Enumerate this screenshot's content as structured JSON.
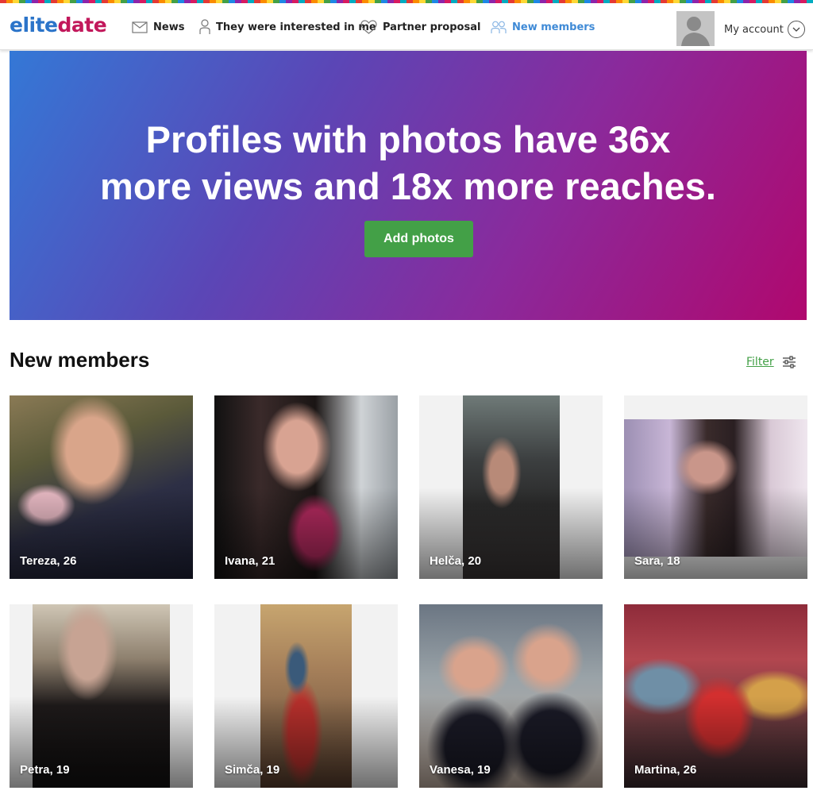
{
  "brand": {
    "part1": "elite",
    "part2": "date"
  },
  "nav": {
    "items": [
      {
        "label": "News",
        "icon": "envelope-icon"
      },
      {
        "label": "They were interested in me",
        "icon": "person-icon"
      },
      {
        "label": "Partner proposal",
        "icon": "heart-icon"
      },
      {
        "label": "New members",
        "icon": "people-icon",
        "active": true
      }
    ],
    "account_label": "My account"
  },
  "banner": {
    "line1": "Profiles with photos have 36x",
    "line2": "more views and 18x more reaches.",
    "button_label": "Add photos"
  },
  "section": {
    "title": "New members",
    "filter_label": "Filter"
  },
  "members": [
    {
      "name": "Tereza, 26"
    },
    {
      "name": "Ivana, 21"
    },
    {
      "name": "Helča, 20"
    },
    {
      "name": "Sara, 18"
    },
    {
      "name": "Petra, 19"
    },
    {
      "name": "Simča, 19"
    },
    {
      "name": "Vanesa, 19"
    },
    {
      "name": "Martina, 26"
    }
  ],
  "colors": {
    "brand_blue": "#2b74c9",
    "brand_pink": "#c2185b",
    "accent_green": "#43a047",
    "active_nav": "#3f8ad6"
  }
}
